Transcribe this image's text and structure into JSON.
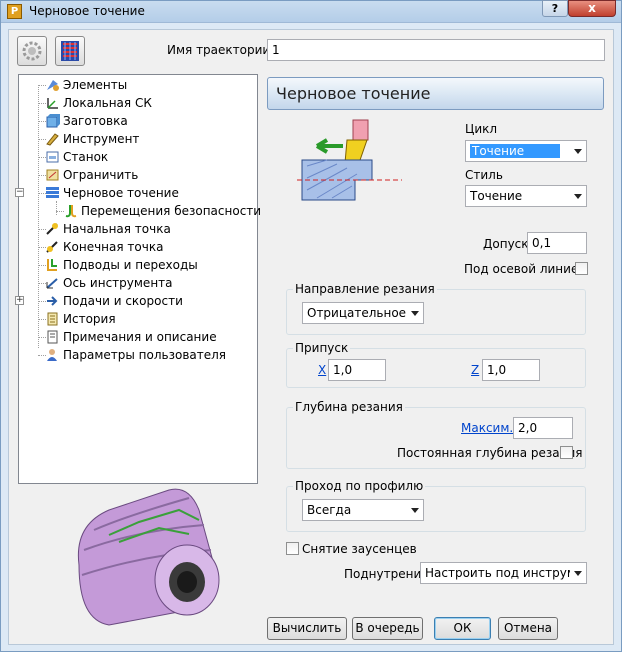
{
  "window": {
    "title": "Черновое точение",
    "app_letter": "P",
    "help": "?",
    "close": "x"
  },
  "toolbar": {
    "btn1_icon": "gear-settings-icon",
    "btn2_icon": "toolpath-icon"
  },
  "name_field": {
    "label": "Имя траектории",
    "value": "1"
  },
  "tree": {
    "items": [
      {
        "label": "Элементы",
        "icon": "elements-icon"
      },
      {
        "label": "Локальная СК",
        "icon": "local-cs-icon"
      },
      {
        "label": "Заготовка",
        "icon": "stock-icon"
      },
      {
        "label": "Инструмент",
        "icon": "tool-icon"
      },
      {
        "label": "Станок",
        "icon": "machine-icon"
      },
      {
        "label": "Ограничить",
        "icon": "limit-icon"
      },
      {
        "label": "Черновое точение",
        "icon": "rough-turning-icon"
      },
      {
        "label": "Перемещения безопасности",
        "icon": "safety-moves-icon"
      },
      {
        "label": "Начальная точка",
        "icon": "start-point-icon"
      },
      {
        "label": "Конечная точка",
        "icon": "end-point-icon"
      },
      {
        "label": "Подводы и переходы",
        "icon": "leads-links-icon"
      },
      {
        "label": "Ось инструмента",
        "icon": "tool-axis-icon"
      },
      {
        "label": "Подачи и скорости",
        "icon": "feeds-speeds-icon"
      },
      {
        "label": "История",
        "icon": "history-icon"
      },
      {
        "label": "Примечания и описание",
        "icon": "notes-icon"
      },
      {
        "label": "Параметры пользователя",
        "icon": "user-params-icon"
      }
    ],
    "expander_minus": "−",
    "expander_plus": "+"
  },
  "panel": {
    "title": "Черновое точение",
    "cycle": {
      "label": "Цикл",
      "value": "Точение"
    },
    "style": {
      "label": "Стиль",
      "value": "Точение"
    },
    "tolerance": {
      "label": "Допуск",
      "value": "0,1"
    },
    "below_axis": {
      "label": "Под осевой линией",
      "checked": false
    },
    "cut_direction": {
      "title": "Направление резания",
      "value": "Отрицательное"
    },
    "allowance": {
      "title": "Припуск",
      "x_label": "X",
      "x_value": "1,0",
      "z_label": "Z",
      "z_value": "1,0"
    },
    "cut_depth": {
      "title": "Глубина резания",
      "max_label": "Максим.",
      "max_value": "2,0",
      "constant_label": "Постоянная глубина резания",
      "constant_checked": false
    },
    "profile_pass": {
      "title": "Проход по профилю",
      "value": "Всегда"
    },
    "deburr": {
      "label": "Снятие заусенцев",
      "checked": false
    },
    "undercut": {
      "label": "Поднутрения",
      "value": "Настроить под инструмен"
    }
  },
  "buttons": {
    "calculate": "Вычислить",
    "queue": "В очередь",
    "ok": "ОК",
    "cancel": "Отмена"
  },
  "colors": {
    "accent": "#3399ff",
    "part": "#c8a0e0",
    "link": "#0044cc"
  }
}
